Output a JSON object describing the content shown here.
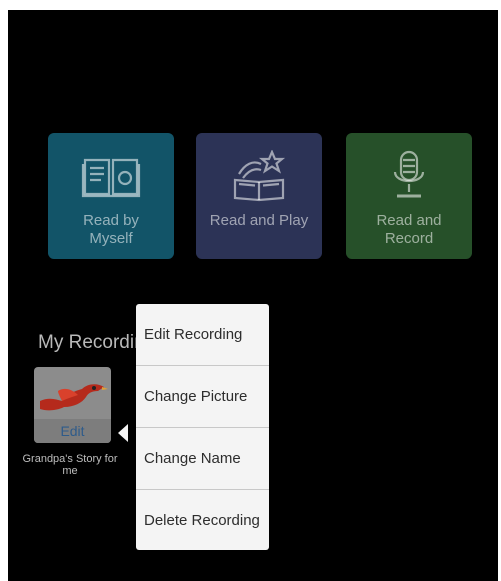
{
  "tiles": [
    {
      "label": "Read by Myself",
      "icon": "open-book-icon"
    },
    {
      "label": "Read and Play",
      "icon": "book-star-icon"
    },
    {
      "label": "Read and Record",
      "icon": "microphone-icon"
    }
  ],
  "my_recordings": {
    "title": "My Recordings",
    "items": [
      {
        "edit_label": "Edit",
        "caption": "Grandpa's Story for me",
        "thumbnail_icon": "bird-icon"
      }
    ]
  },
  "context_menu": {
    "items": [
      "Edit Recording",
      "Change Picture",
      "Change Name",
      "Delete Recording"
    ]
  },
  "colors": {
    "tile_read_myself": "#125468",
    "tile_read_play": "#2c3356",
    "tile_read_record": "#265029",
    "background": "#000000",
    "menu_background": "#f4f4f4"
  }
}
